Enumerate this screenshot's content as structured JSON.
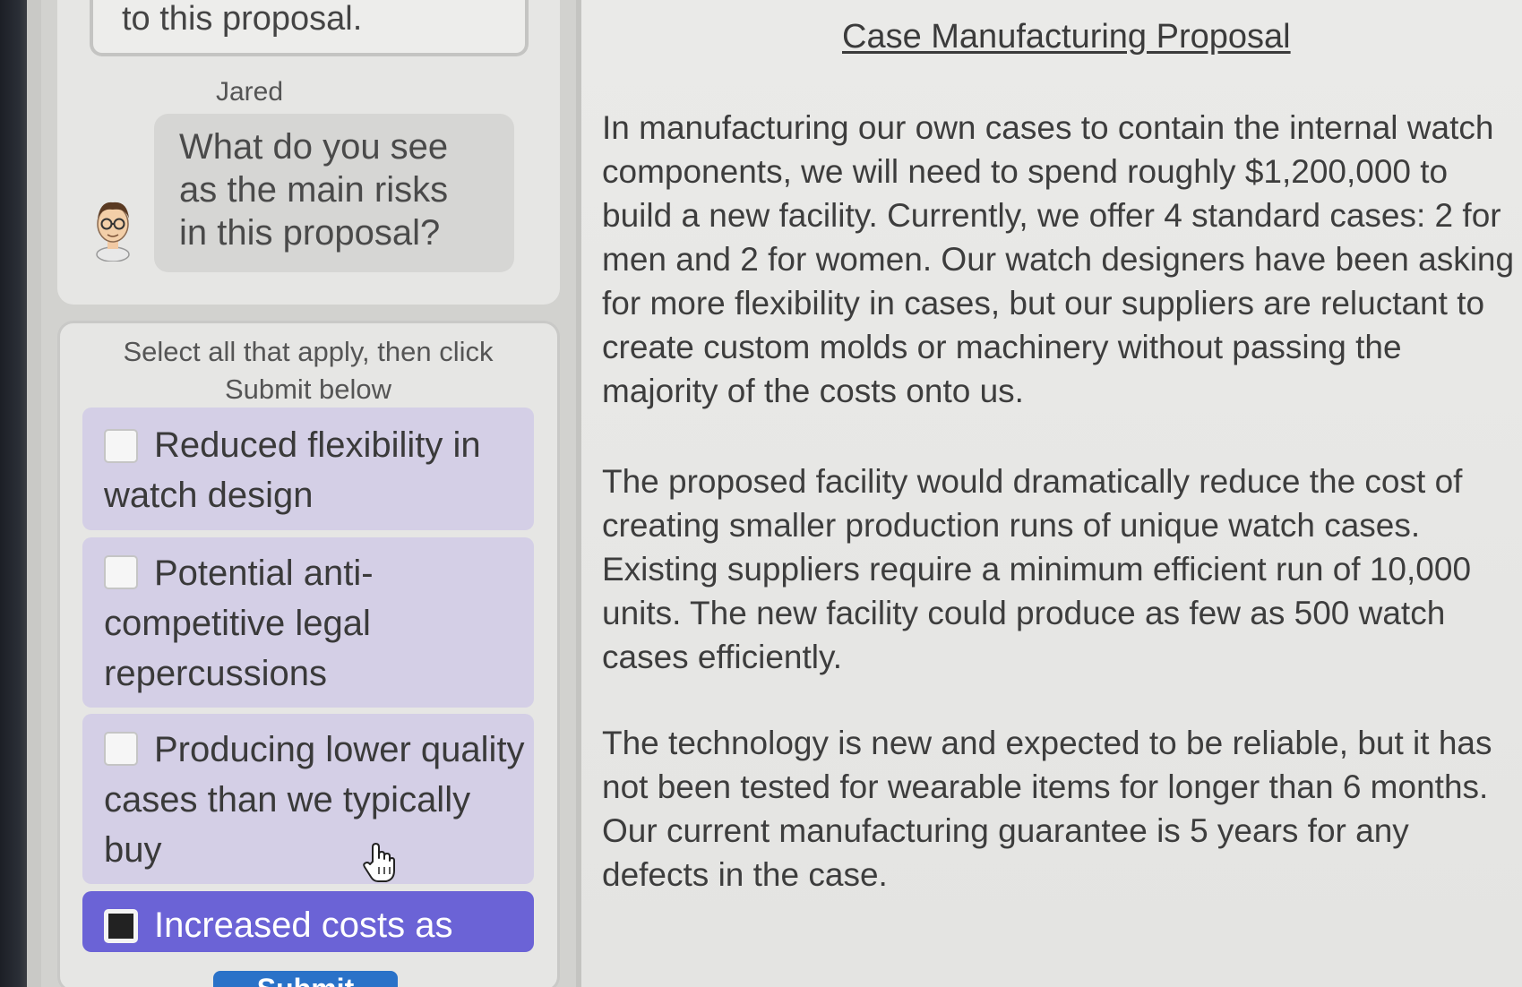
{
  "chat": {
    "previous_message_tail": "to this proposal.",
    "speaker": "Jared",
    "question": "What do you see as the main risks in this proposal?"
  },
  "question_card": {
    "instructions": "Select all that apply, then click Submit below",
    "options": [
      {
        "label": "Reduced flexibility in watch design",
        "checked": false
      },
      {
        "label": "Potential anti-competitive legal repercussions",
        "checked": false
      },
      {
        "label": "Producing lower quality cases than we typically buy",
        "checked": false
      },
      {
        "label": "Increased costs as",
        "checked": true
      }
    ],
    "submit_label": "Submit"
  },
  "document": {
    "title": "Case Manufacturing Proposal",
    "paragraphs": [
      "In manufacturing our own cases to contain the internal watch components, we will need to spend roughly $1,200,000 to build a new facility. Currently, we offer 4 standard cases: 2 for men and 2 for women. Our watch designers have been asking for more flexibility in cases, but our suppliers are reluctant to create custom molds or machinery without passing the majority of the costs onto us.",
      "The proposed facility would dramatically reduce the cost of creating smaller production runs of unique watch cases. Existing suppliers require a minimum efficient run of 10,000 units. The new facility could produce as few as 500 watch cases efficiently.",
      "The technology is new and expected to be reliable, but it has not been tested for wearable items for longer than 6 months. Our current manufacturing guarantee is 5 years for any defects in the case."
    ]
  },
  "colors": {
    "option_bg": "#d4cfe6",
    "option_selected_bg": "#6b63d6",
    "submit_bg": "#2a72c8"
  },
  "icons": {
    "avatar": "character-avatar-icon",
    "cursor": "hand-pointer-icon"
  }
}
